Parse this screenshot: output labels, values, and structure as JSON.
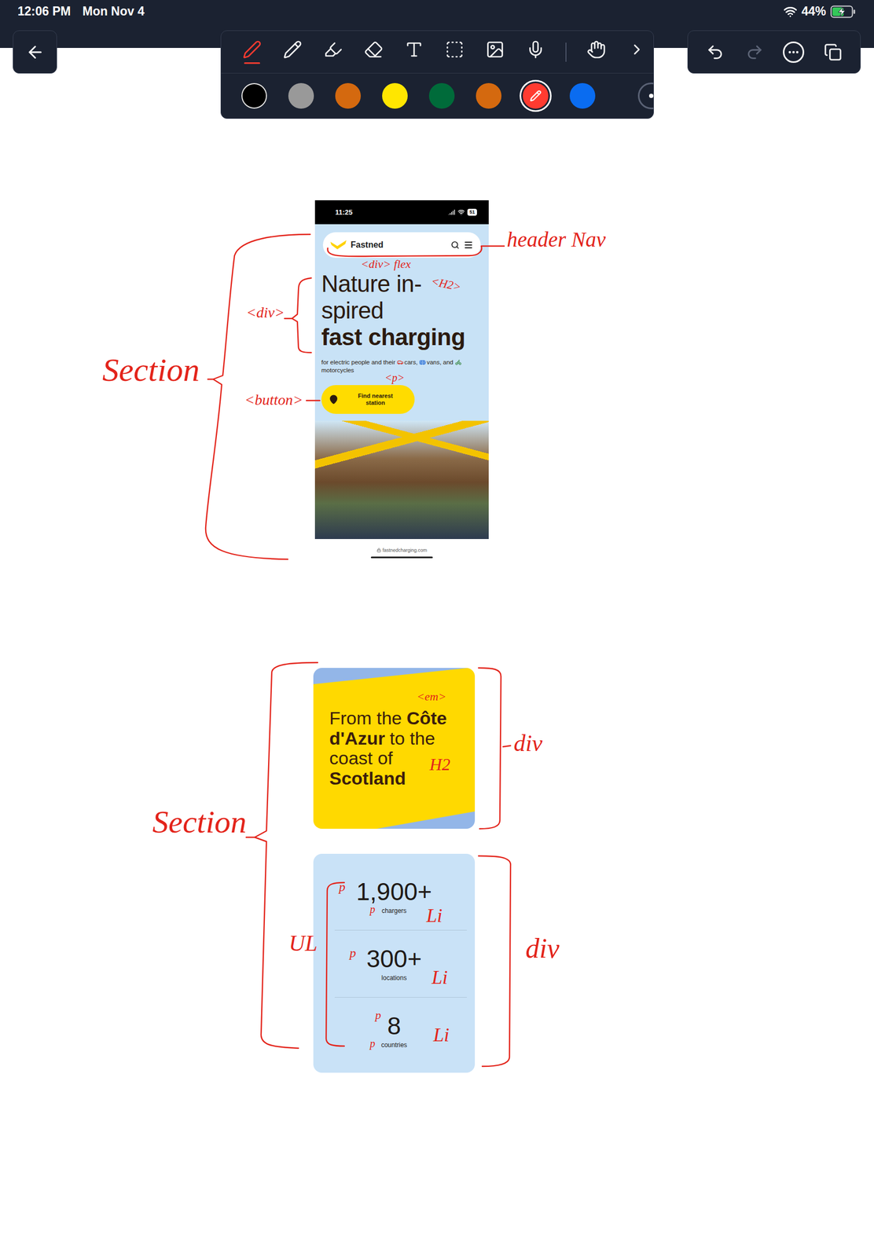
{
  "status_bar": {
    "time": "12:06 PM",
    "date": "Mon Nov 4",
    "battery": "44%",
    "charging": true,
    "level": 0.44
  },
  "toolbar": {
    "tools": [
      {
        "kind": "pen",
        "selected": true
      },
      {
        "kind": "pencil",
        "selected": false
      },
      {
        "kind": "highlighter",
        "selected": false
      },
      {
        "kind": "eraser",
        "selected": false
      },
      {
        "kind": "text",
        "selected": false
      },
      {
        "kind": "select",
        "selected": false
      },
      {
        "kind": "image",
        "selected": false
      },
      {
        "kind": "mic",
        "selected": false
      },
      {
        "kind": "touch",
        "selected": false
      }
    ],
    "colors": [
      {
        "color": "#000000",
        "selected": false
      },
      {
        "color": "#999999",
        "selected": false
      },
      {
        "color": "#d4690f",
        "selected": false
      },
      {
        "color": "#ffe600",
        "selected": false
      },
      {
        "color": "#006b3a",
        "selected": false
      },
      {
        "color": "#d4690f",
        "selected": false
      },
      {
        "color": "#ff3b30",
        "selected": true
      },
      {
        "color": "#0a6cf0",
        "selected": false
      }
    ]
  },
  "actions": [
    {
      "kind": "undo",
      "disabled": false
    },
    {
      "kind": "redo",
      "disabled": true
    },
    {
      "kind": "more",
      "disabled": false
    },
    {
      "kind": "pages",
      "disabled": false
    }
  ],
  "screenshot_hero": {
    "status_time": "11:25",
    "status_battery": "51",
    "logo": "Fastned",
    "title_lines": [
      "Nature in-",
      "spired"
    ],
    "title_bold": "fast charging",
    "subtitle": [
      {
        "kind": "text",
        "text": "for electric people and their"
      },
      {
        "kind": "car"
      },
      {
        "kind": "text",
        "text": "cars,"
      },
      {
        "kind": "van"
      },
      {
        "kind": "text",
        "text": "vans, and"
      },
      {
        "kind": "motorcycle"
      },
      {
        "kind": "text",
        "text": "motorcycles"
      }
    ],
    "button": "Find nearest station",
    "url": "fastnedcharging.com"
  },
  "screenshot_coverage": {
    "lines": [
      [
        {
          "text": "From the",
          "bold": false
        },
        {
          "text": "Côte",
          "bold": true
        }
      ],
      [
        {
          "text": "d'Azur",
          "bold": true
        },
        {
          "text": "to the",
          "bold": false
        }
      ],
      [
        {
          "text": "coast of",
          "bold": false
        }
      ],
      [
        {
          "text": "Scotland",
          "bold": true
        }
      ]
    ]
  },
  "screenshot_stats": {
    "stats": [
      {
        "value": "1,900+",
        "label": "chargers"
      },
      {
        "value": "300+",
        "label": "locations"
      },
      {
        "value": "8",
        "label": "countries"
      }
    ]
  },
  "annotations": [
    {
      "text": "header Nav"
    },
    {
      "text": "<div> flex"
    },
    {
      "text": "<H2>"
    },
    {
      "text": "<div>"
    },
    {
      "text": "Section"
    },
    {
      "text": "<p>"
    },
    {
      "text": "<button>"
    },
    {
      "text": "<em>"
    },
    {
      "text": "H2"
    },
    {
      "text": "div"
    },
    {
      "text": "Section"
    },
    {
      "text": "UL"
    },
    {
      "text": "div"
    },
    {
      "text": "p"
    },
    {
      "text": "p"
    },
    {
      "text": "Li"
    },
    {
      "text": "p"
    },
    {
      "text": "Li"
    },
    {
      "text": "p"
    },
    {
      "text": "p"
    },
    {
      "text": "Li"
    }
  ]
}
